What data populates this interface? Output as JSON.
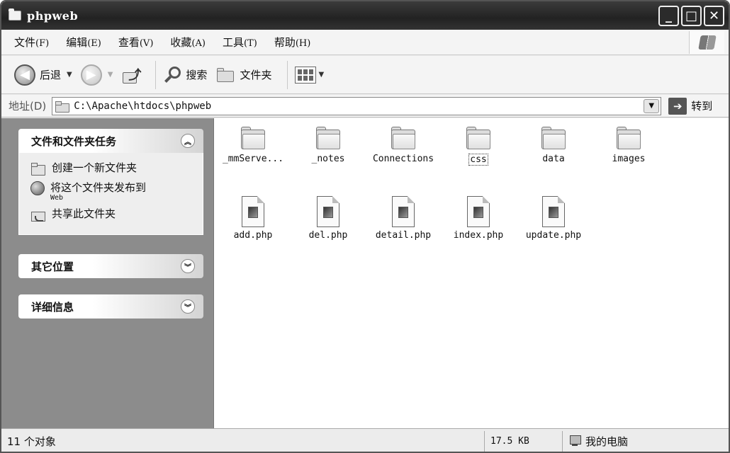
{
  "window": {
    "title": "phpweb",
    "caption_buttons": {
      "minimize": "_",
      "maximize": "□",
      "close": "✕"
    }
  },
  "menu": [
    {
      "label": "文件",
      "accel": "(F)"
    },
    {
      "label": "编辑",
      "accel": "(E)"
    },
    {
      "label": "查看",
      "accel": "(V)"
    },
    {
      "label": "收藏",
      "accel": "(A)"
    },
    {
      "label": "工具",
      "accel": "(T)"
    },
    {
      "label": "帮助",
      "accel": "(H)"
    }
  ],
  "toolbar": {
    "back_label": "后退",
    "search_label": "搜索",
    "folders_label": "文件夹"
  },
  "address": {
    "label": "地址(D)",
    "path": "C:\\Apache\\htdocs\\phpweb",
    "go_label": "转到"
  },
  "tasks_panel": {
    "title": "文件和文件夹任务",
    "items": [
      {
        "label": "创建一个新文件夹",
        "sub": ""
      },
      {
        "label": "将这个文件夹发布到",
        "sub": "Web"
      },
      {
        "label": "共享此文件夹",
        "sub": ""
      }
    ]
  },
  "other_places": {
    "title": "其它位置"
  },
  "details": {
    "title": "详细信息"
  },
  "files": [
    {
      "name": "_mmServe...",
      "type": "folder"
    },
    {
      "name": "_notes",
      "type": "folder"
    },
    {
      "name": "Connections",
      "type": "folder"
    },
    {
      "name": "css",
      "type": "folder",
      "focused": true
    },
    {
      "name": "data",
      "type": "folder"
    },
    {
      "name": "images",
      "type": "folder"
    },
    {
      "name": "add.php",
      "type": "php"
    },
    {
      "name": "del.php",
      "type": "php"
    },
    {
      "name": "detail.php",
      "type": "php"
    },
    {
      "name": "index.php",
      "type": "php"
    },
    {
      "name": "update.php",
      "type": "php"
    }
  ],
  "status": {
    "count": "11 个对象",
    "size": "17.5 KB",
    "location": "我的电脑"
  }
}
